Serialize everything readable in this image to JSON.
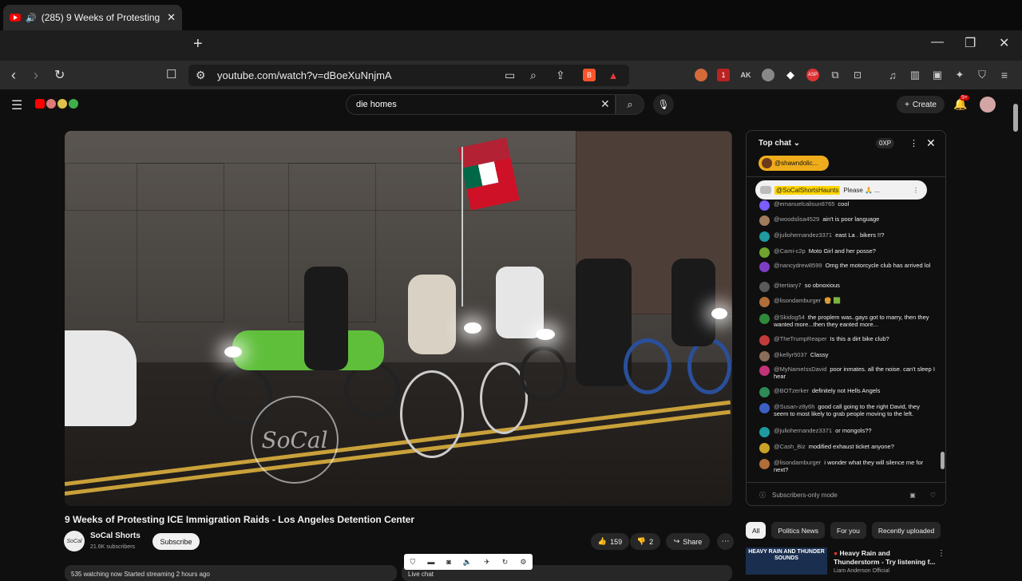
{
  "browser": {
    "tab_title": "(285) 9 Weeks of Protesting I",
    "url": "youtube.com/watch?v=dBoeXuNnjmA",
    "ext_badge": "1"
  },
  "header": {
    "search_query": "die homes",
    "create_label": "Create",
    "notif_count": "9+"
  },
  "video": {
    "title": "9 Weeks of Protesting ICE Immigration Raids - Los Angeles Detention Center",
    "channel": "SoCal Shorts",
    "subscribers": "21.6K subscribers",
    "subscribe_label": "Subscribe",
    "likes": "159",
    "dislikes": "2",
    "share_label": "Share",
    "watermark": "SoCal",
    "watching": "535 watching now  Started streaming 2 hours ago",
    "live_chat_label": "Live chat"
  },
  "chat": {
    "mode_label": "Top chat",
    "xp_label": "0XP",
    "sticker_user": "@shawndolic...",
    "pinned_user": "@SoCalShortsHaunts",
    "pinned_text": "Please 🙏 ...",
    "messages": [
      {
        "user": "@emanuelcalisun8765",
        "text": "cool",
        "color": "#7a5cff"
      },
      {
        "user": "@woodslisa4529",
        "text": "ain't is poor language",
        "color": "#a07b5c"
      },
      {
        "user": "@juliohernandez3371",
        "text": "east La . bikers !!?",
        "color": "#1e9aa0"
      },
      {
        "user": "@Cami-c2p",
        "text": "Moto Girl and her posse?",
        "color": "#6fa32d"
      },
      {
        "user": "@nancydrew8599",
        "text": "Omg the motorcycle club has arrived lol",
        "color": "#7e3ec4"
      },
      {
        "user": "@tertiary7",
        "text": "so obnoxious",
        "color": "#5a5a5a"
      },
      {
        "user": "@lisondamburger",
        "text": "🍔 🟩",
        "color": "#b06d3a"
      },
      {
        "user": "@Skidog54",
        "text": "the proplem was..gays got to marry, then they wanted more...then they eanted more...",
        "color": "#2f8a3a"
      },
      {
        "user": "@TheTrumpReaper",
        "text": "Is this a dirt bike club?",
        "color": "#c23b3b"
      },
      {
        "user": "@kellyr5037",
        "text": "Classy",
        "color": "#8a6d5a"
      },
      {
        "user": "@MyNameIssDavid",
        "text": "poor inmates. all the noise. can't sleep I hear",
        "color": "#c2337a"
      },
      {
        "user": "@BOTzerker",
        "text": "definitely not Hells Angels",
        "color": "#2e8b57"
      },
      {
        "user": "@Susan-z8y6h",
        "text": "good call going to the right David, they seem to most likely to grab people moving to the left.",
        "color": "#3c5fc4"
      },
      {
        "user": "@juliohernandez3371",
        "text": "or mongols??",
        "color": "#1e9aa0"
      },
      {
        "user": "@Cash_Biz",
        "text": "modified exhaust ticket anyone?",
        "color": "#c9a227"
      },
      {
        "user": "@lisondamburger",
        "text": "i wonder what they will silence me for next?",
        "color": "#b06d3a"
      }
    ],
    "footer_label": "Subscribers-only mode"
  },
  "chips": [
    "All",
    "Politics News",
    "For you",
    "Recently uploaded"
  ],
  "recommendation": {
    "thumb_text": "HEAVY RAIN AND THUNDER SOUNDS",
    "title": "Heavy Rain and Thunderstorm - Try listening f...",
    "author": "Liam Anderson Official"
  }
}
